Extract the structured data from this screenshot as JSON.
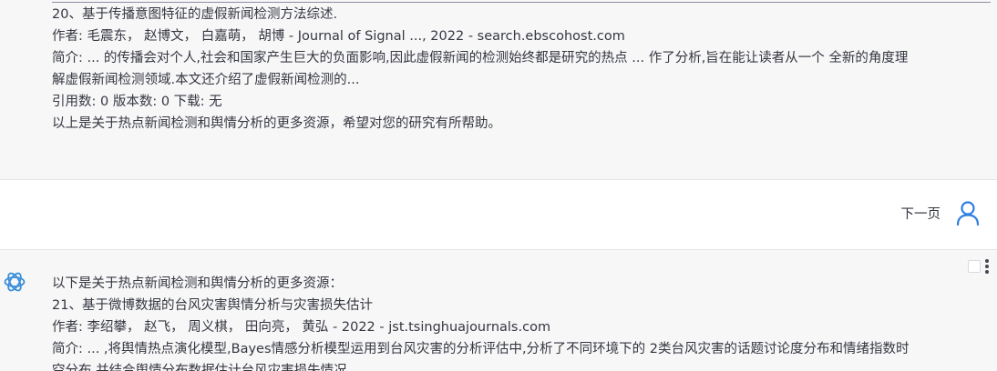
{
  "previous_message": {
    "lines": [
      "20、基于传播意图特征的虚假新闻检测方法综述.",
      "作者: 毛震东，  赵博文，  白嘉萌，  胡博 - Journal of Signal ..., 2022 - search.ebscohost.com",
      "简介: ... 的传播会对个人,社会和国家产生巨大的负面影响,因此虚假新闻的检测始终都是研究的热点 ... 作了分析,旨在能让读者从一个 全新的角度理",
      "解虚假新闻检测领域.本文还介绍了虚假新闻检测的...",
      "引用数: 0 版本数: 0 下载: 无",
      "以上是关于热点新闻检测和舆情分析的更多资源，希望对您的研究有所帮助。"
    ]
  },
  "user_message": {
    "text": "下一页",
    "avatar_icon": "user-icon"
  },
  "assistant_message": {
    "avatar_icon": "openai-logo-icon",
    "lines": [
      "以下是关于热点新闻检测和舆情分析的更多资源：",
      "21、基于微博数据的台风灾害舆情分析与灾害损失估计",
      "作者: 李绍攀，  赵飞，  周义棋，  田向亮，  黄弘 - 2022 - jst.tsinghuajournals.com",
      "简介: ... ,将舆情热点演化模型,Bayes情感分析模型运用到台风灾害的分析评估中,分析了不同环境下的 2类台风灾害的话题讨论度分布和情绪指数时",
      "空分布,并结合舆情分布数据估计台风灾害损失情况..."
    ]
  },
  "colors": {
    "assistant_bg": "#f7f7f8",
    "user_bg": "#ffffff",
    "accent": "#2f7ee0",
    "bot_icon": "#3b8fd9"
  }
}
